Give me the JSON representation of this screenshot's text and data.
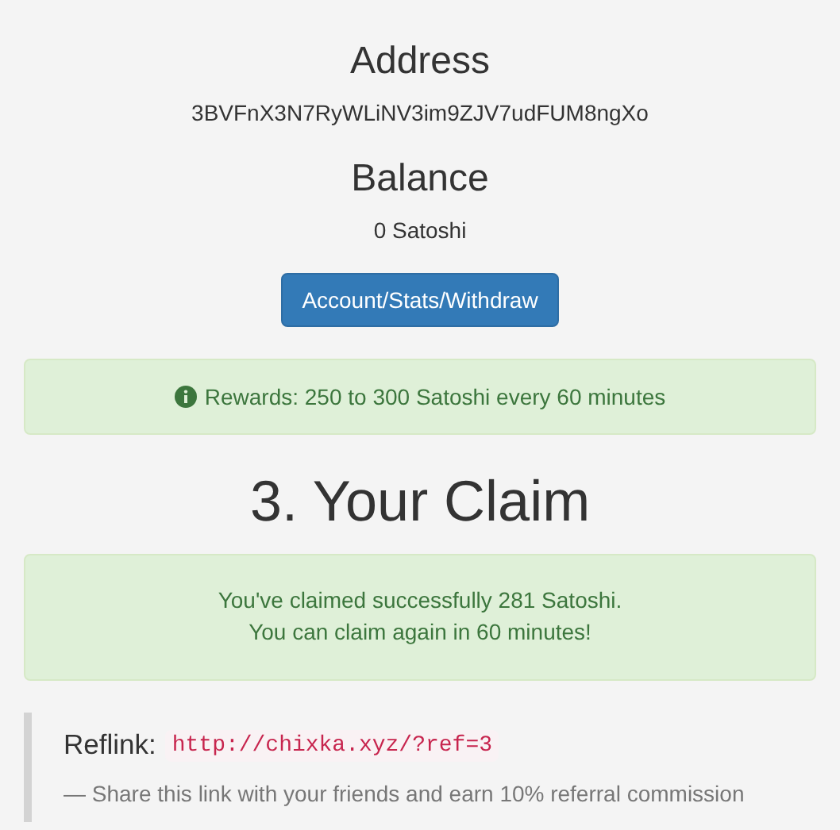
{
  "address": {
    "heading": "Address",
    "value": "3BVFnX3N7RyWLiNV3im9ZJV7udFUM8ngXo"
  },
  "balance": {
    "heading": "Balance",
    "value": "0 Satoshi"
  },
  "account_button": "Account/Stats/Withdraw",
  "rewards_alert": "Rewards: 250 to 300 Satoshi every 60 minutes",
  "claim_heading": "3. Your Claim",
  "claim_alert": [
    "You've claimed successfully 281 Satoshi.",
    "You can claim again in 60 minutes!"
  ],
  "reflink": {
    "label": "Reflink:",
    "url": "http://chixka.xyz/?ref=3",
    "note": "— Share this link with your friends and earn 10% referral commission"
  }
}
